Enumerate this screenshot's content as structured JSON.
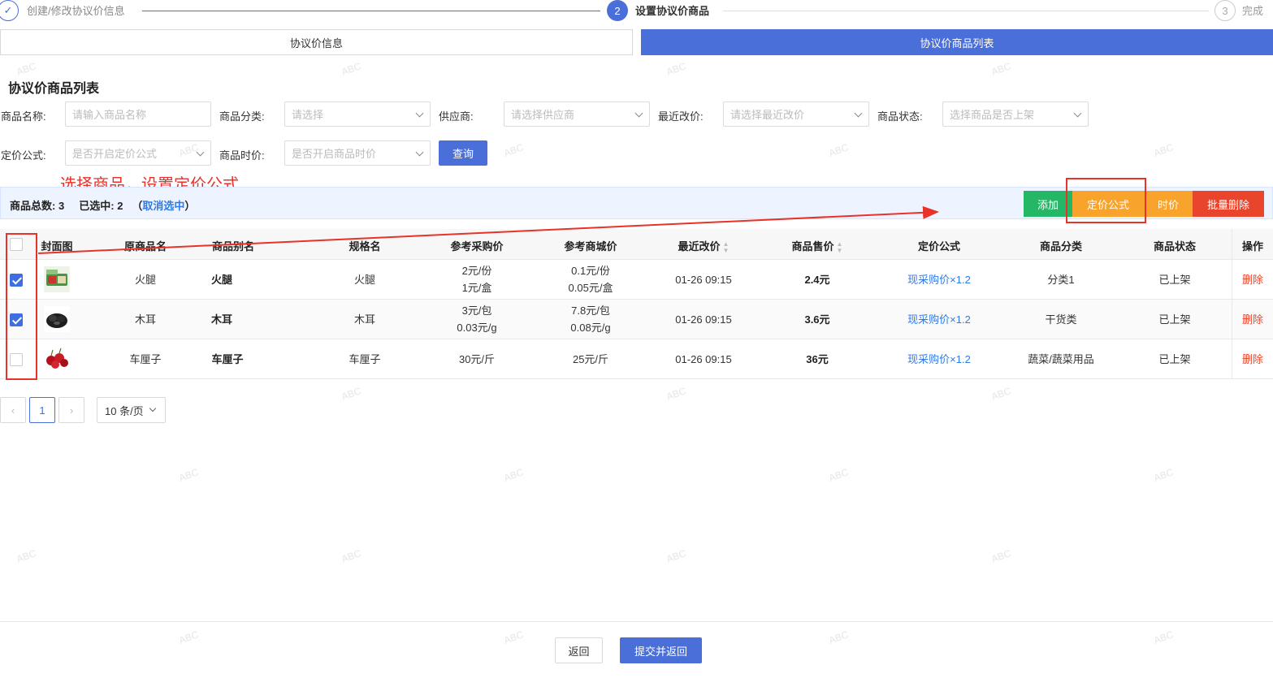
{
  "steps": [
    {
      "number": "✓",
      "label": "创建/修改协议价信息",
      "state": "done"
    },
    {
      "number": "2",
      "label": "设置协议价商品",
      "state": "active"
    },
    {
      "number": "3",
      "label": "完成",
      "state": "pending"
    }
  ],
  "tabs": {
    "info": "协议价信息",
    "list": "协议价商品列表"
  },
  "section_title": "协议价商品列表",
  "filters": {
    "name": {
      "label": "商品名称:",
      "placeholder": "请输入商品名称"
    },
    "category": {
      "label": "商品分类:",
      "placeholder": "请选择"
    },
    "supplier": {
      "label": "供应商:",
      "placeholder": "请选择供应商"
    },
    "recent": {
      "label": "最近改价:",
      "placeholder": "请选择最近改价"
    },
    "status": {
      "label": "商品状态:",
      "placeholder": "选择商品是否上架"
    },
    "formula": {
      "label": "定价公式:",
      "placeholder": "是否开启定价公式"
    },
    "timeprice": {
      "label": "商品时价:",
      "placeholder": "是否开启商品时价"
    },
    "query_label": "查询"
  },
  "annotation": {
    "text": "选择商品，设置定价公式",
    "color": "#e8322a"
  },
  "summary": {
    "total_label": "商品总数:",
    "total": "3",
    "selected_label": "已选中:",
    "selected": "2",
    "open_paren": "（",
    "cancel_label": "取消选中",
    "close_paren": "）"
  },
  "actions": {
    "add": "添加",
    "formula": "定价公式",
    "time": "时价",
    "batch_delete": "批量删除"
  },
  "table": {
    "headers": {
      "cover": "封面图",
      "orig_name": "原商品名",
      "alias": "商品别名",
      "spec": "规格名",
      "ref_purchase": "参考采购价",
      "ref_mall": "参考商城价",
      "recent": "最近改价",
      "price": "商品售价",
      "formula": "定价公式",
      "category": "商品分类",
      "status": "商品状态",
      "op": "操作"
    },
    "rows": [
      {
        "checked": true,
        "thumb": "ham",
        "orig_name": "火腿",
        "alias": "火腿",
        "spec": "火腿",
        "ref_purchase": [
          "2元/份",
          "1元/盒"
        ],
        "ref_mall": [
          "0.1元/份",
          "0.05元/盒"
        ],
        "recent": "01-26 09:15",
        "price": "2.4元",
        "formula": "现采购价×1.2",
        "category": "分类1",
        "status": "已上架",
        "op": "删除"
      },
      {
        "checked": true,
        "thumb": "fungus",
        "orig_name": "木耳",
        "alias": "木耳",
        "spec": "木耳",
        "ref_purchase": [
          "3元/包",
          "0.03元/g"
        ],
        "ref_mall": [
          "7.8元/包",
          "0.08元/g"
        ],
        "recent": "01-26 09:15",
        "price": "3.6元",
        "formula": "现采购价×1.2",
        "category": "干货类",
        "status": "已上架",
        "op": "删除"
      },
      {
        "checked": false,
        "thumb": "cherry",
        "orig_name": "车厘子",
        "alias": "车厘子",
        "spec": "车厘子",
        "ref_purchase": [
          "30元/斤"
        ],
        "ref_mall": [
          "25元/斤"
        ],
        "recent": "01-26 09:15",
        "price": "36元",
        "formula": "现采购价×1.2",
        "category": "蔬菜/蔬菜用品",
        "status": "已上架",
        "op": "删除"
      }
    ]
  },
  "pagination": {
    "prev": "‹",
    "current": "1",
    "next": "›",
    "page_size": "10 条/页"
  },
  "footer": {
    "back": "返回",
    "submit": "提交并返回"
  },
  "watermark": "ABC"
}
